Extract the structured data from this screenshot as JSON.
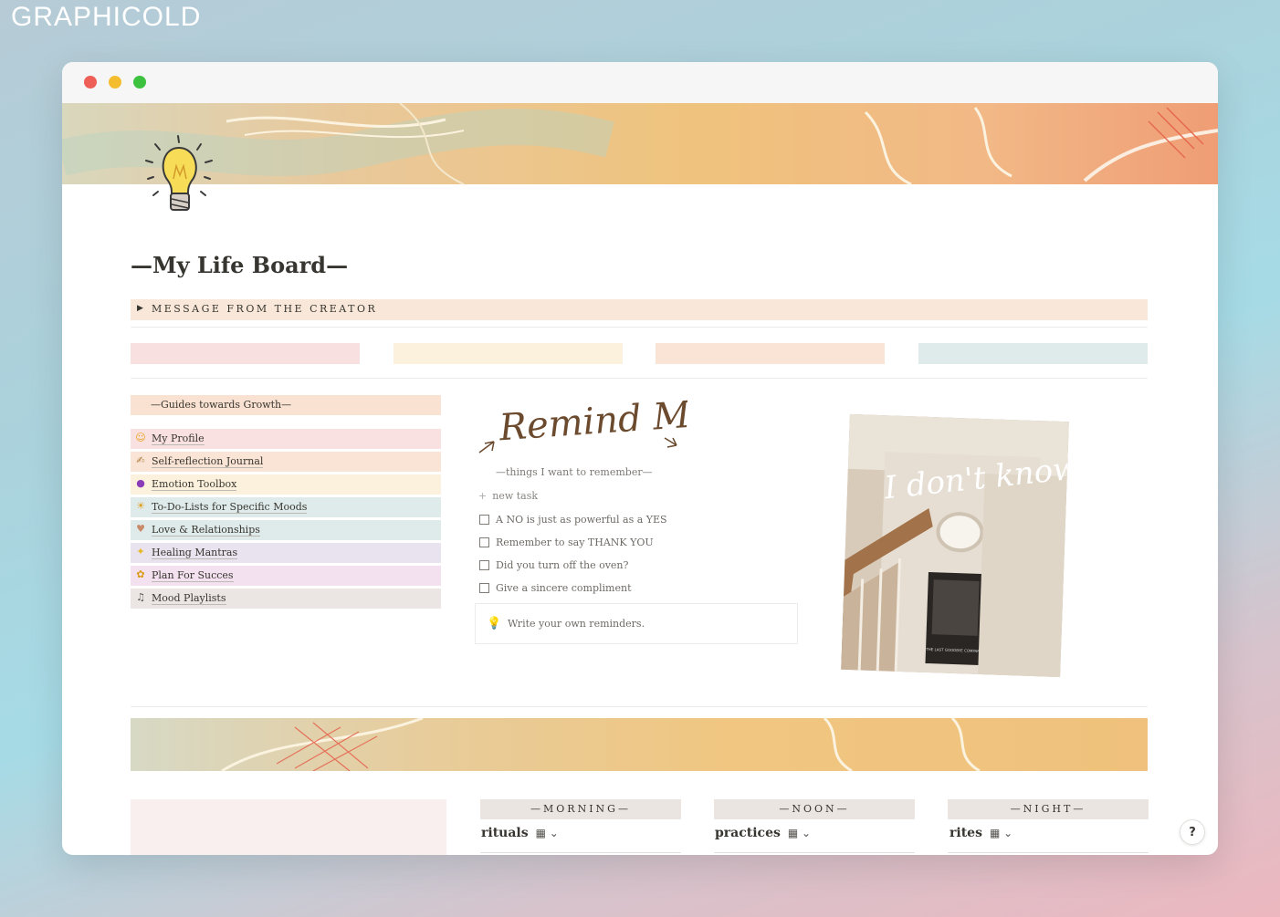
{
  "brand": "GRAPHICOLD",
  "page": {
    "title": "—My Life Board—"
  },
  "callout": {
    "label": "MESSAGE FROM THE CREATOR"
  },
  "swatch_colors": [
    "#f9e0e0",
    "#fcf1dc",
    "#f9e4d5",
    "#dfeaeb"
  ],
  "guides": {
    "heading": "—Guides towards Growth—",
    "items": [
      {
        "label": "My Profile",
        "icon": "smiling-face-icon",
        "color": "#f9e1e1"
      },
      {
        "label": "Self-reflection Journal",
        "icon": "writing-hand-icon",
        "color": "#f9e4d6"
      },
      {
        "label": "Emotion Toolbox",
        "icon": "crystal-ball-icon",
        "color": "#fcf1dc"
      },
      {
        "label": "To-Do-Lists for Specific Moods",
        "icon": "weather-icon",
        "color": "#dfeaea"
      },
      {
        "label": "Love & Relationships",
        "icon": "hands-icon",
        "color": "#dfeaea"
      },
      {
        "label": "Healing Mantras",
        "icon": "sparkle-icon",
        "color": "#e8e3ef"
      },
      {
        "label": "Plan For Succes",
        "icon": "sunflower-icon",
        "color": "#f3e1ef"
      },
      {
        "label": "Mood Playlists",
        "icon": "music-icon",
        "color": "#ebe6e4"
      }
    ]
  },
  "remind": {
    "heading": "Remind Me",
    "subtitle": "—things I want to remember—",
    "new_task": "new task",
    "tasks": [
      "A NO is just as powerful as a YES",
      "Remember to say THANK YOU",
      "Did you turn off the oven?",
      "Give a sincere compliment"
    ],
    "write_placeholder": "Write your own reminders."
  },
  "photo": {
    "handwriting": "I don't know",
    "poster_caption": "THE LAST GOODBYE COMPANY"
  },
  "schedule": [
    {
      "heading": "—MORNING—",
      "label": "rituals"
    },
    {
      "heading": "—NOON—",
      "label": "practices"
    },
    {
      "heading": "—NIGHT—",
      "label": "rites"
    }
  ],
  "help": "?"
}
